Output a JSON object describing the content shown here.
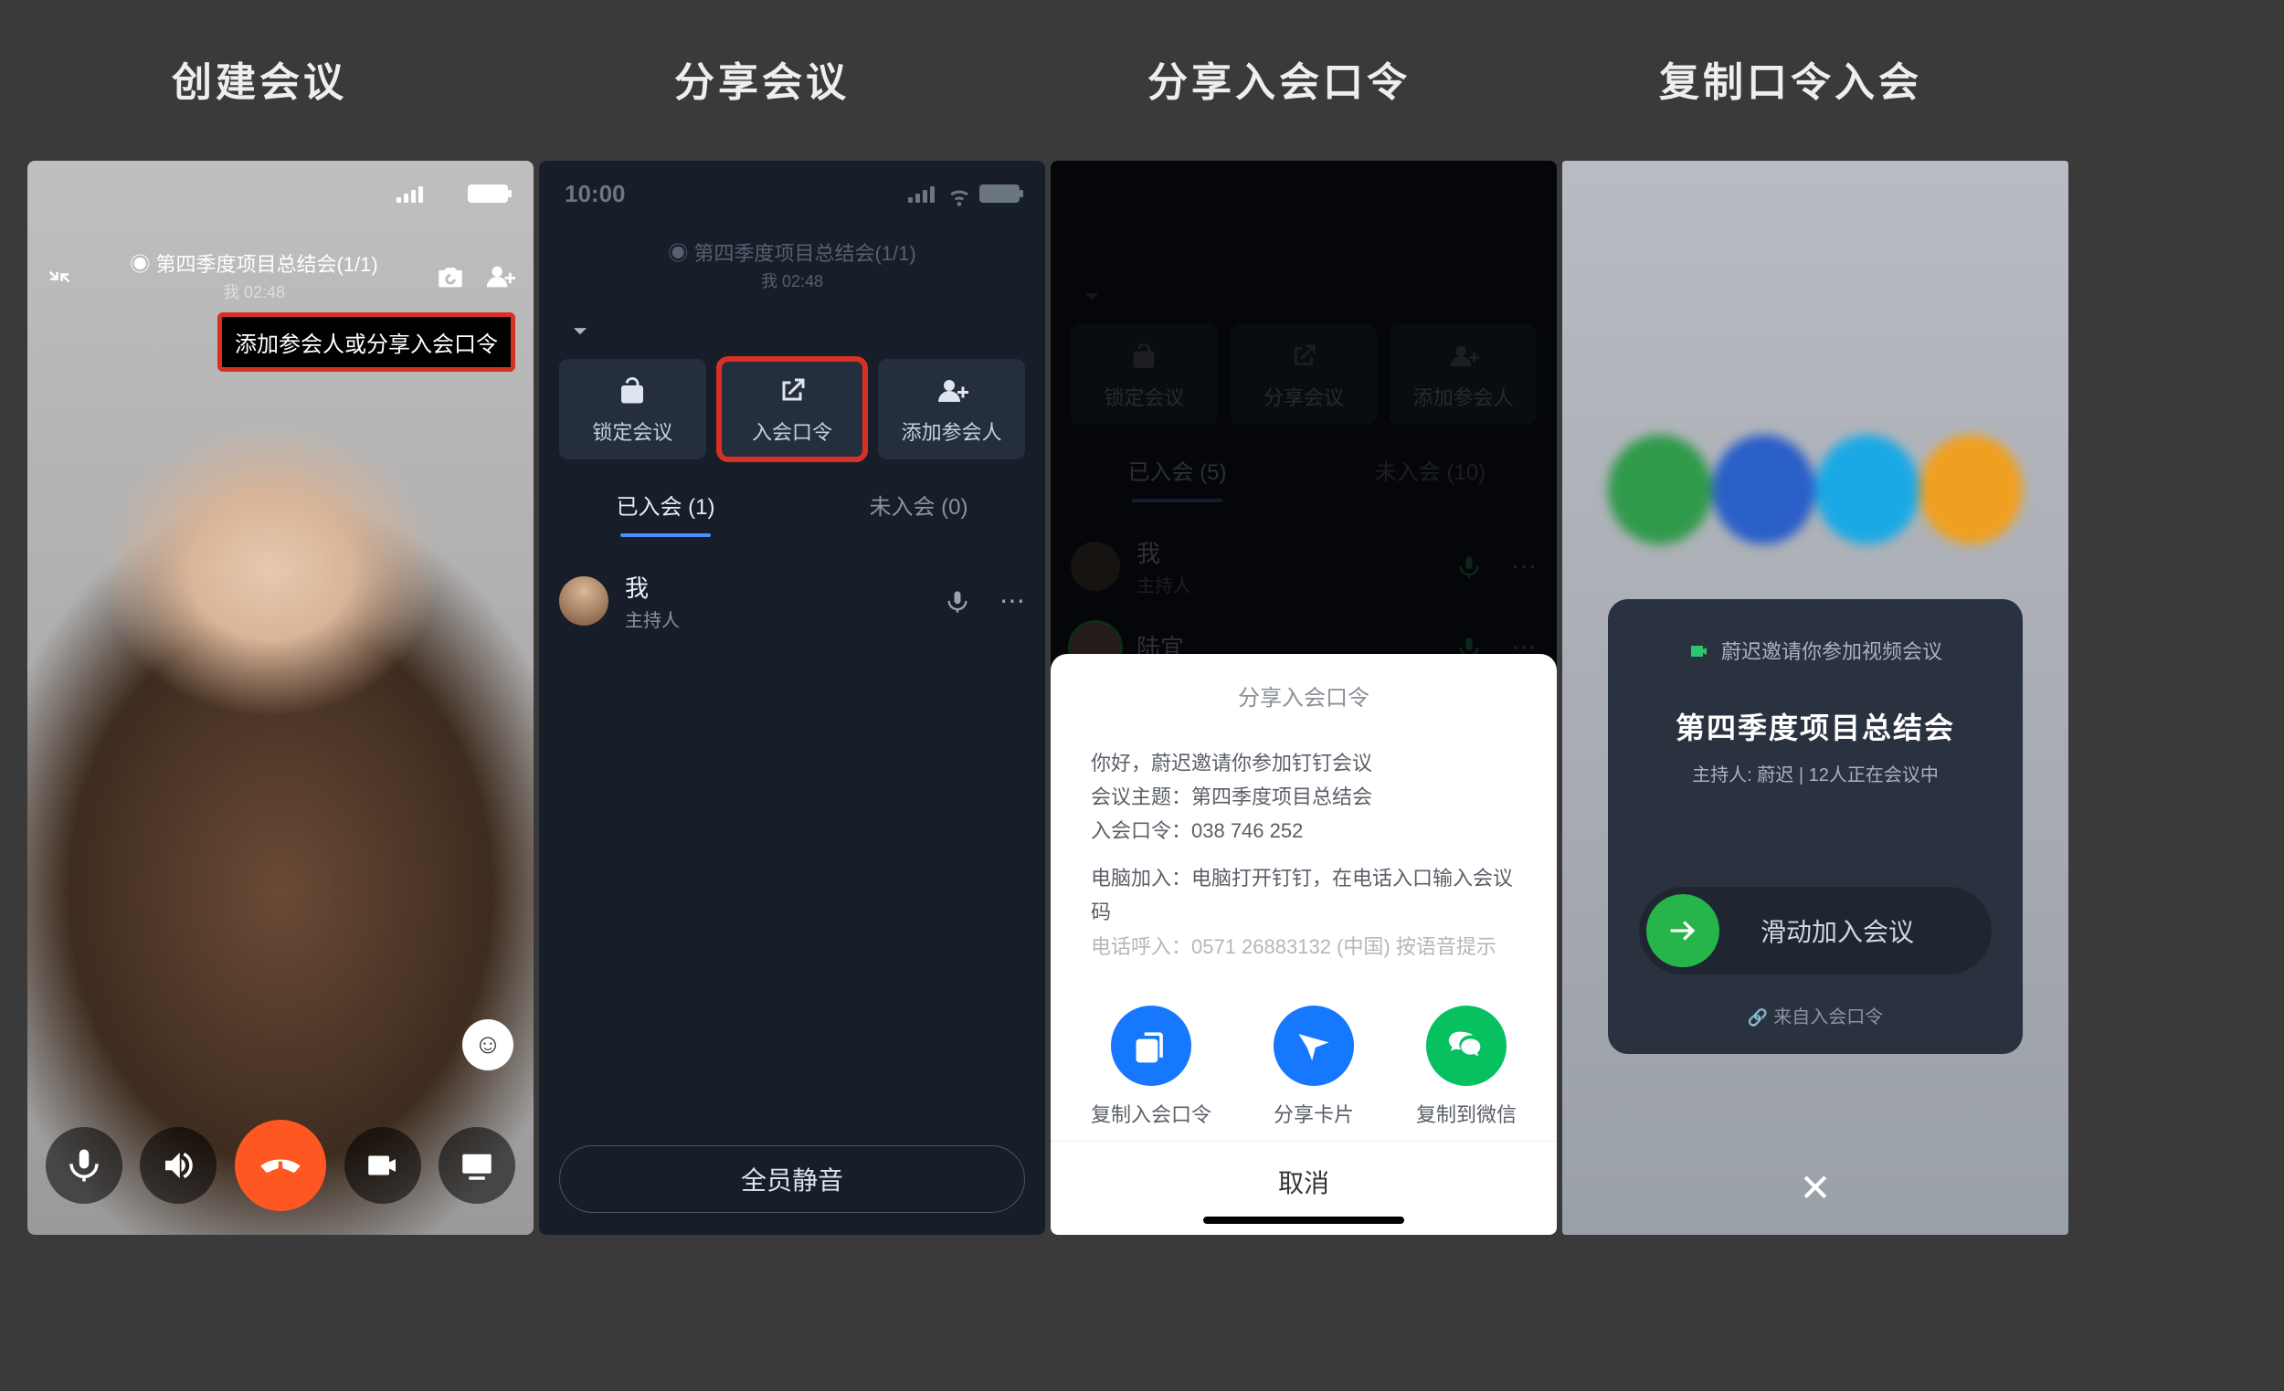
{
  "titles": {
    "col1": "创建会议",
    "col2": "分享会议",
    "col3": "分享入会口令",
    "col4": "复制口令入会"
  },
  "status": {
    "time": "10:00"
  },
  "panel1": {
    "meeting_title": "第四季度项目总结会(1/1)",
    "meeting_sub": "我 02:48",
    "tooltip": "添加参会人或分享入会口令"
  },
  "panel2": {
    "top_title": "第四季度项目总结会(1/1)",
    "top_sub": "我 02:48",
    "actions": {
      "lock": "锁定会议",
      "code": "入会口令",
      "add": "添加参会人"
    },
    "tabs": {
      "joined": "已入会 (1)",
      "notjoined": "未入会 (0)"
    },
    "participants": [
      {
        "name": "我",
        "role": "主持人"
      }
    ],
    "mute_all": "全员静音"
  },
  "panel3": {
    "actions": {
      "lock": "锁定会议",
      "share": "分享会议",
      "add": "添加参会人"
    },
    "tabs": {
      "joined": "已入会 (5)",
      "notjoined": "未入会 (10)"
    },
    "participants": [
      {
        "name": "我",
        "role": "主持人"
      },
      {
        "name": "陆宜",
        "role": ""
      }
    ],
    "sheet_title": "分享入会口令",
    "msg_line1": "你好，蔚迟邀请你参加钉钉会议",
    "msg_line2": "会议主题：第四季度项目总结会",
    "msg_line3": "入会口令：038 746 252",
    "msg_line4": "电脑加入：电脑打开钉钉，在电话入口输入会议码",
    "msg_line5": "电话呼入：0571  26883132 (中国)    按语音提示",
    "share": {
      "copy": "复制入会口令",
      "card": "分享卡片",
      "wechat": "复制到微信"
    },
    "cancel": "取消"
  },
  "panel4": {
    "invite_header": "蔚迟邀请你参加视频会议",
    "meeting_title": "第四季度项目总结会",
    "meeting_sub": "主持人: 蔚迟 | 12人正在会议中",
    "slide_label": "滑动加入会议",
    "source": "来自入会口令"
  }
}
